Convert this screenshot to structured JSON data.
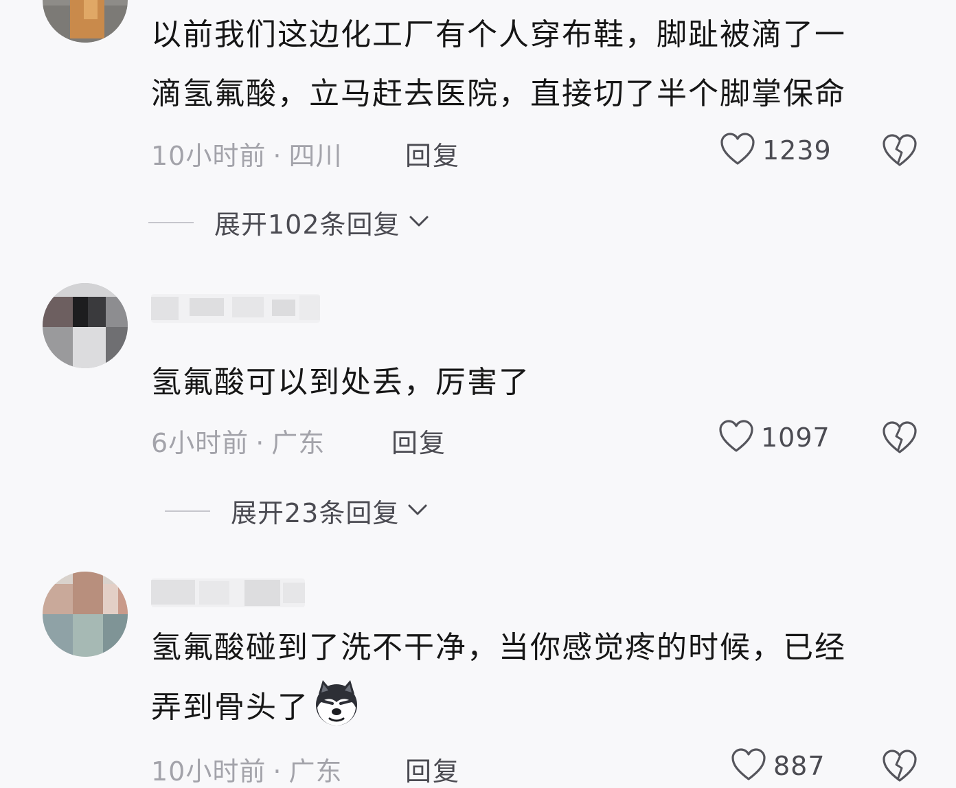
{
  "comments": [
    {
      "lines": [
        "以前我们这边化工厂有个人穿布鞋，脚趾被滴了一",
        "滴氢氟酸，立马赶去医院，直接切了半个脚掌保命"
      ],
      "time": "10小时前",
      "location": "四川",
      "reply_label": "回复",
      "likes": "1239",
      "expand_label": "展开102条回复"
    },
    {
      "lines": [
        "氢氟酸可以到处丢，厉害了"
      ],
      "time": "6小时前",
      "location": "广东",
      "reply_label": "回复",
      "likes": "1097",
      "expand_label": "展开23条回复"
    },
    {
      "lines": [
        "氢氟酸碰到了洗不干净，当你感觉疼的时候，已经",
        "弄到骨头了"
      ],
      "time": "10小时前",
      "location": "广东",
      "reply_label": "回复",
      "likes": "887",
      "emoji": "doge-emoji"
    }
  ],
  "meta_separator": "·",
  "icons": {
    "like": "heart-outline-icon",
    "dislike": "broken-heart-icon",
    "expand": "chevron-down-icon"
  },
  "colors": {
    "background": "#f8f8fa",
    "text": "#161616",
    "meta": "#a3a3aa",
    "secondary": "#4b4b52"
  }
}
